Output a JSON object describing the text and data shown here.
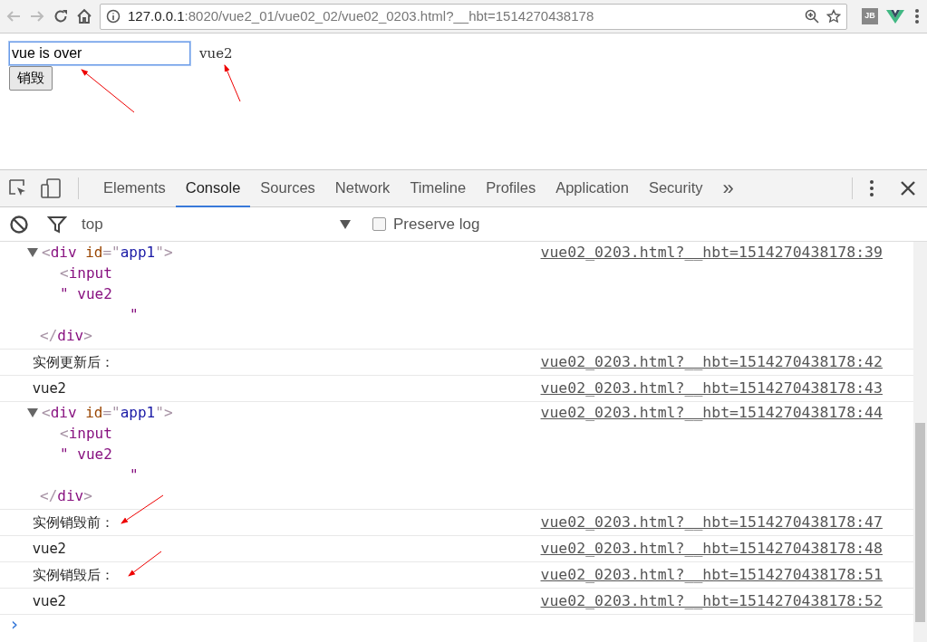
{
  "browser": {
    "url_host": "127.0.0.1",
    "url_path": ":8020/vue2_01/vue02_02/vue02_0203.html?__hbt=1514270438178",
    "extension_label": "JB"
  },
  "page": {
    "input_value": "vue is over",
    "bound_text": "vue2",
    "destroy_button": "销毁"
  },
  "devtools": {
    "tabs": [
      {
        "label": "Elements",
        "selected": false
      },
      {
        "label": "Console",
        "selected": true
      },
      {
        "label": "Sources",
        "selected": false
      },
      {
        "label": "Network",
        "selected": false
      },
      {
        "label": "Timeline",
        "selected": false
      },
      {
        "label": "Profiles",
        "selected": false
      },
      {
        "label": "Application",
        "selected": false
      },
      {
        "label": "Security",
        "selected": false
      }
    ],
    "more_tabs": "»",
    "context": "top",
    "preserve_log": {
      "label": "Preserve log",
      "checked": false
    },
    "entries": [
      {
        "kind": "element",
        "expanded": true,
        "head": [
          {
            "t": "<",
            "kind": "punct"
          },
          {
            "t": "div",
            "kind": "tag"
          },
          {
            "t": " id",
            "kind": "attr"
          },
          {
            "t": "=\"",
            "kind": "punct"
          },
          {
            "t": "app1",
            "kind": "value"
          },
          {
            "t": "\">",
            "kind": "punct"
          }
        ],
        "children": [
          [
            {
              "t": "<",
              "kind": "punct"
            },
            {
              "t": "input",
              "kind": "tag"
            }
          ],
          [
            {
              "t": "\" vue2\n        \"",
              "kind": "text"
            }
          ]
        ],
        "tail": [
          {
            "t": "</",
            "kind": "punct"
          },
          {
            "t": "div",
            "kind": "tag"
          },
          {
            "t": ">",
            "kind": "punct"
          }
        ],
        "source": "vue02_0203.html?__hbt=1514270438178:39"
      },
      {
        "kind": "text",
        "text": "实例更新后：",
        "source": "vue02_0203.html?__hbt=1514270438178:42"
      },
      {
        "kind": "text",
        "text": "vue2",
        "source": "vue02_0203.html?__hbt=1514270438178:43"
      },
      {
        "kind": "element",
        "expanded": true,
        "head": [
          {
            "t": "<",
            "kind": "punct"
          },
          {
            "t": "div",
            "kind": "tag"
          },
          {
            "t": " id",
            "kind": "attr"
          },
          {
            "t": "=\"",
            "kind": "punct"
          },
          {
            "t": "app1",
            "kind": "value"
          },
          {
            "t": "\">",
            "kind": "punct"
          }
        ],
        "children": [
          [
            {
              "t": "<",
              "kind": "punct"
            },
            {
              "t": "input",
              "kind": "tag"
            }
          ],
          [
            {
              "t": "\" vue2\n        \"",
              "kind": "text"
            }
          ]
        ],
        "tail": [
          {
            "t": "</",
            "kind": "punct"
          },
          {
            "t": "div",
            "kind": "tag"
          },
          {
            "t": ">",
            "kind": "punct"
          }
        ],
        "source": "vue02_0203.html?__hbt=1514270438178:44"
      },
      {
        "kind": "text",
        "text": "实例销毁前：",
        "source": "vue02_0203.html?__hbt=1514270438178:47"
      },
      {
        "kind": "text",
        "text": "vue2",
        "source": "vue02_0203.html?__hbt=1514270438178:48"
      },
      {
        "kind": "text",
        "text": "实例销毁后：",
        "source": "vue02_0203.html?__hbt=1514270438178:51"
      },
      {
        "kind": "text",
        "text": "vue2",
        "source": "vue02_0203.html?__hbt=1514270438178:52"
      }
    ],
    "prompt": "›"
  }
}
